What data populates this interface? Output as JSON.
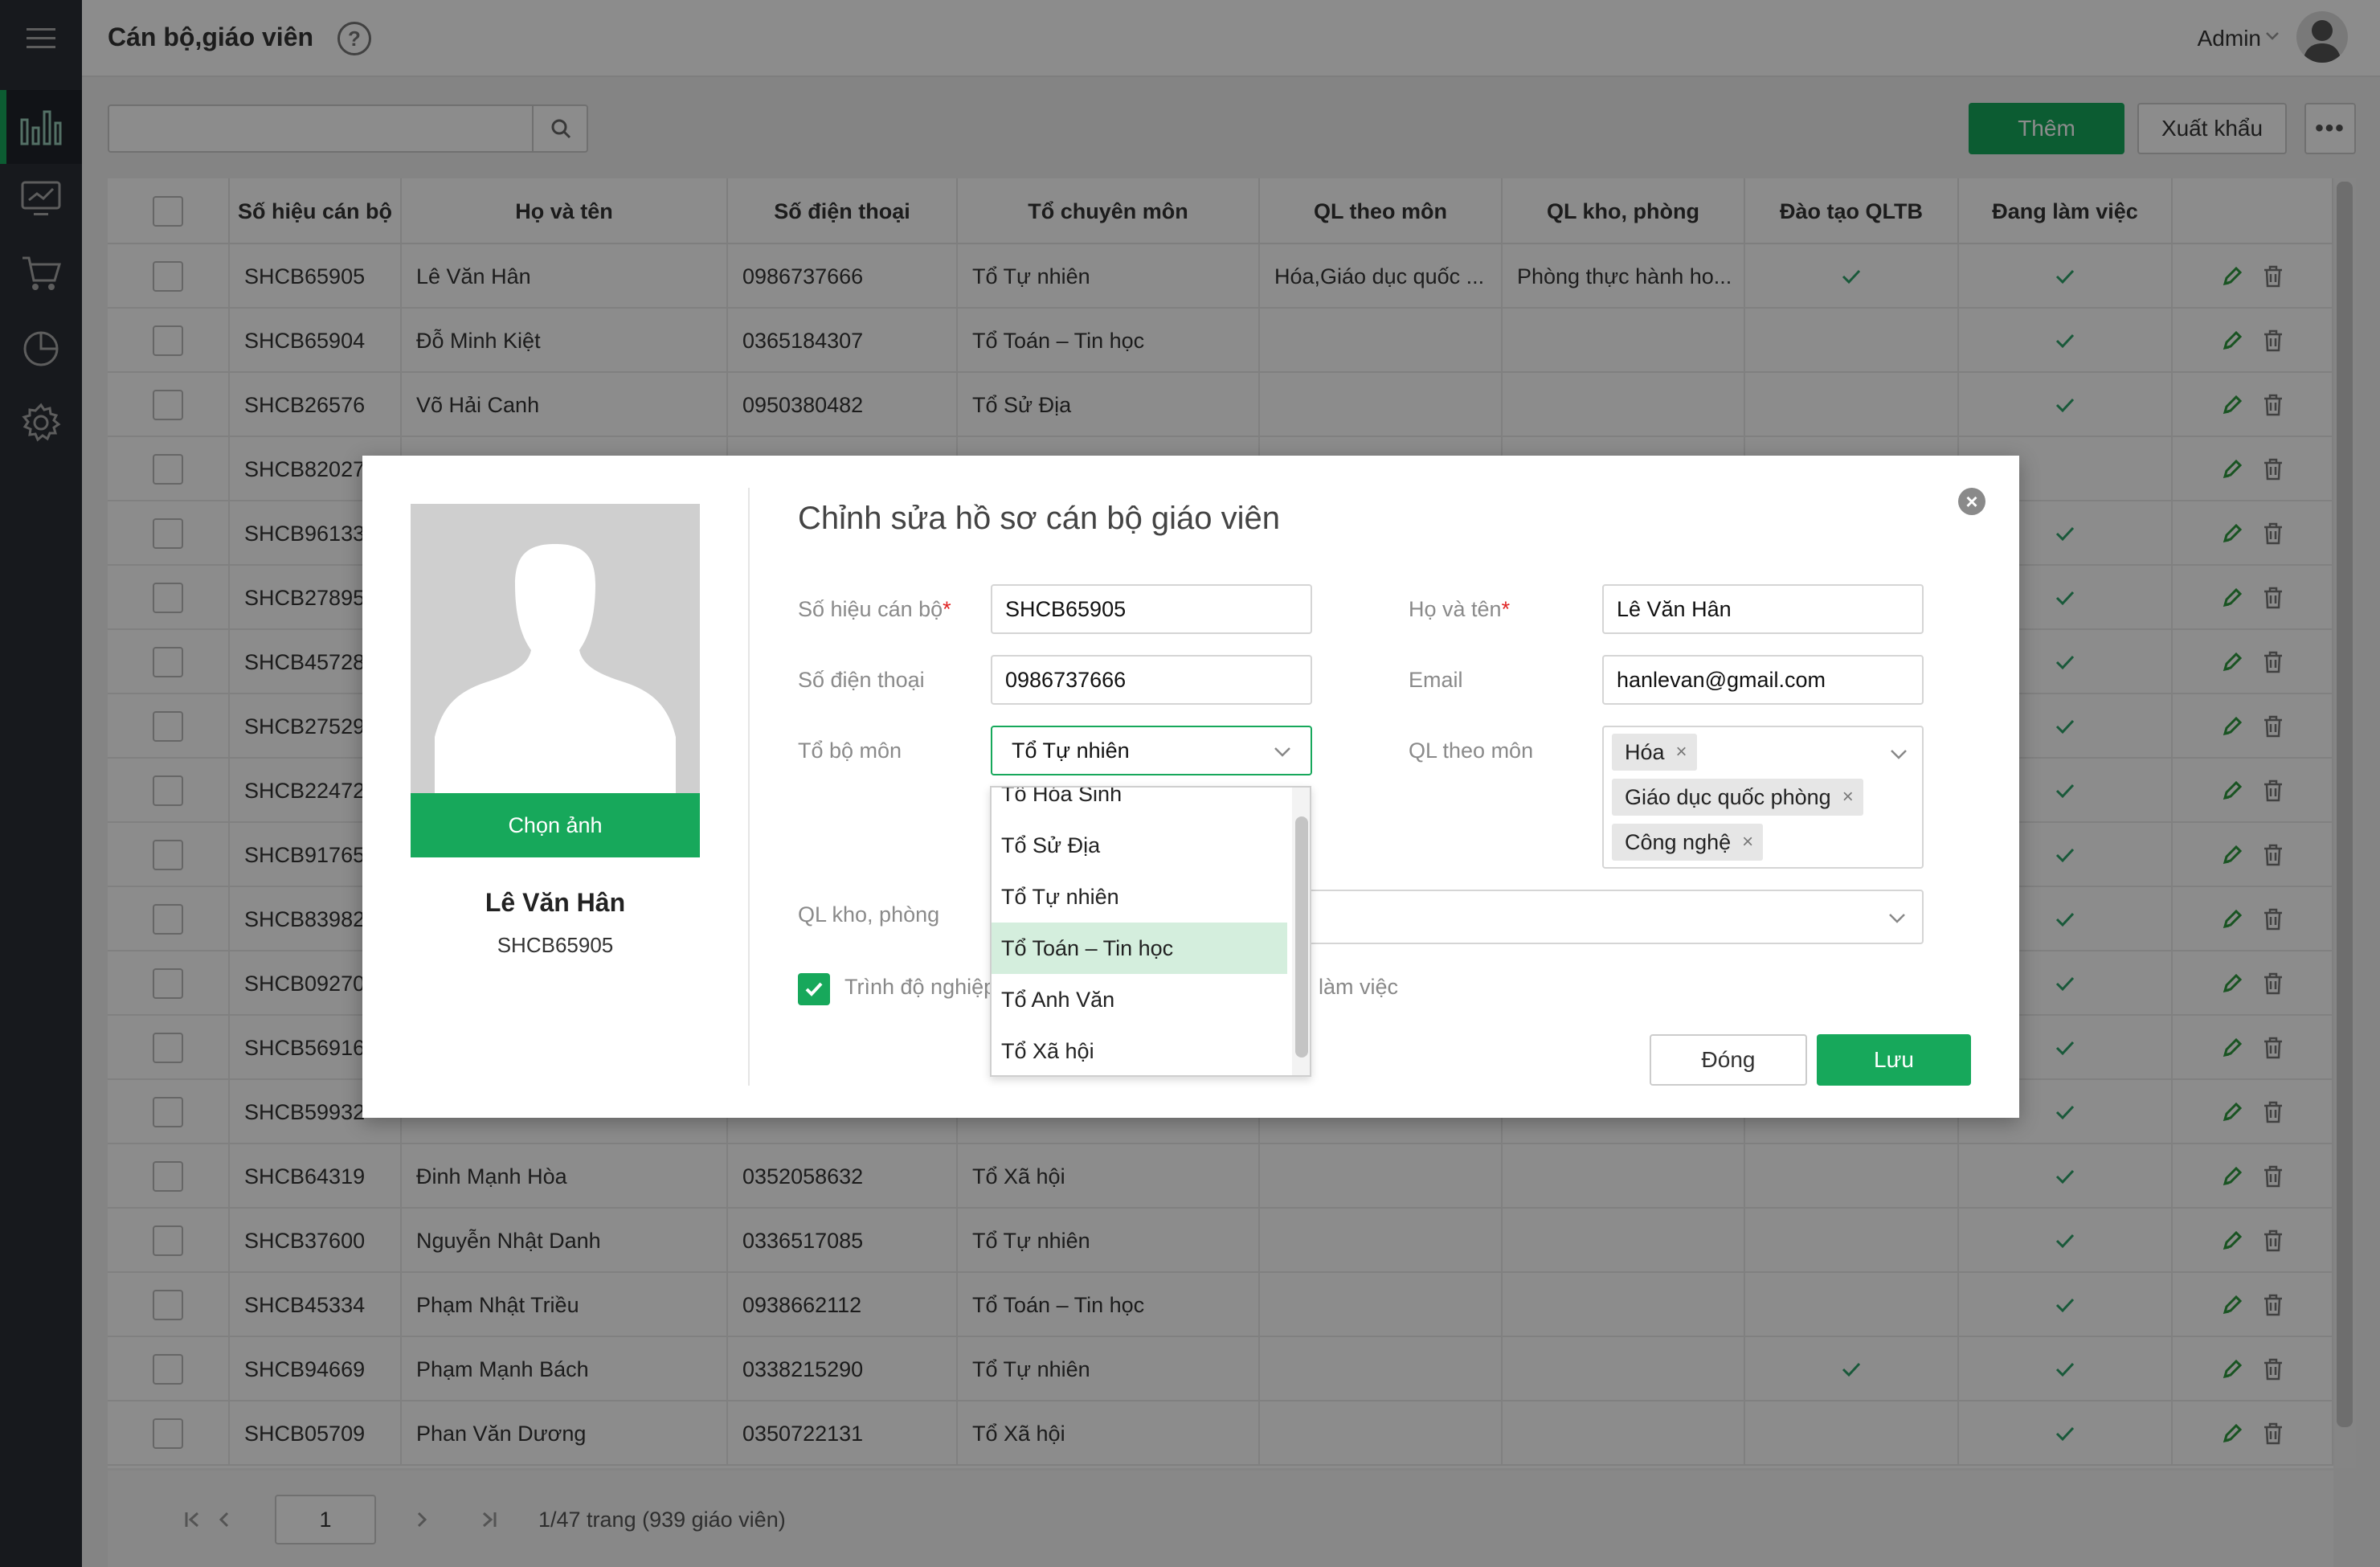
{
  "header": {
    "title": "Cán bộ,giáo viên",
    "help": "?",
    "user_name": "Admin"
  },
  "toolbar": {
    "search_placeholder": "",
    "add_label": "Thêm",
    "export_label": "Xuất khẩu",
    "more_label": "•••"
  },
  "table": {
    "headers": [
      "Số hiệu cán bộ",
      "Họ và tên",
      "Số điện thoại",
      "Tổ chuyên môn",
      "QL theo môn",
      "QL kho, phòng",
      "Đào tạo QLTB",
      "Đang làm việc"
    ],
    "rows": [
      {
        "code": "SHCB65905",
        "name": "Lê Văn Hân",
        "phone": "0986737666",
        "dept": "Tổ Tự nhiên",
        "subject": "Hóa,Giáo dục quốc ...",
        "room": "Phòng thực hành ho...",
        "trained": true,
        "active": true
      },
      {
        "code": "SHCB65904",
        "name": "Đỗ Minh Kiệt",
        "phone": "0365184307",
        "dept": "Tổ Toán – Tin học",
        "subject": "",
        "room": "",
        "trained": false,
        "active": true
      },
      {
        "code": "SHCB26576",
        "name": "Võ Hải Canh",
        "phone": "0950380482",
        "dept": "Tổ Sử Địa",
        "subject": "",
        "room": "",
        "trained": false,
        "active": true
      },
      {
        "code": "SHCB82027",
        "name": "",
        "phone": "",
        "dept": "",
        "subject": "",
        "room": "",
        "trained": false,
        "active": false
      },
      {
        "code": "SHCB96133",
        "name": "",
        "phone": "",
        "dept": "",
        "subject": "",
        "room": "",
        "trained": false,
        "active": true
      },
      {
        "code": "SHCB27895",
        "name": "",
        "phone": "",
        "dept": "",
        "subject": "",
        "room": "",
        "trained": false,
        "active": true
      },
      {
        "code": "SHCB45728",
        "name": "",
        "phone": "",
        "dept": "",
        "subject": "",
        "room": "",
        "trained": false,
        "active": true
      },
      {
        "code": "SHCB27529",
        "name": "",
        "phone": "",
        "dept": "",
        "subject": "",
        "room": "",
        "trained": false,
        "active": true
      },
      {
        "code": "SHCB22472",
        "name": "",
        "phone": "",
        "dept": "",
        "subject": "",
        "room": "",
        "trained": false,
        "active": true
      },
      {
        "code": "SHCB91765",
        "name": "",
        "phone": "",
        "dept": "",
        "subject": "",
        "room": "",
        "trained": false,
        "active": true
      },
      {
        "code": "SHCB83982",
        "name": "",
        "phone": "",
        "dept": "",
        "subject": "",
        "room": "",
        "trained": false,
        "active": true
      },
      {
        "code": "SHCB09270",
        "name": "",
        "phone": "",
        "dept": "",
        "subject": "",
        "room": "",
        "trained": false,
        "active": true
      },
      {
        "code": "SHCB56916",
        "name": "",
        "phone": "",
        "dept": "",
        "subject": "",
        "room": "",
        "trained": false,
        "active": true
      },
      {
        "code": "SHCB59932",
        "name": "",
        "phone": "",
        "dept": "",
        "subject": "",
        "room": "",
        "trained": false,
        "active": true
      },
      {
        "code": "SHCB64319",
        "name": "Đinh Mạnh Hòa",
        "phone": "0352058632",
        "dept": "Tổ Xã hội",
        "subject": "",
        "room": "",
        "trained": false,
        "active": true
      },
      {
        "code": "SHCB37600",
        "name": "Nguyễn Nhật Danh",
        "phone": "0336517085",
        "dept": "Tổ Tự nhiên",
        "subject": "",
        "room": "",
        "trained": false,
        "active": true
      },
      {
        "code": "SHCB45334",
        "name": "Phạm Nhật Triều",
        "phone": "0938662112",
        "dept": "Tổ Toán – Tin học",
        "subject": "",
        "room": "",
        "trained": false,
        "active": true
      },
      {
        "code": "SHCB94669",
        "name": "Phạm Mạnh Bách",
        "phone": "0338215290",
        "dept": "Tổ Tự nhiên",
        "subject": "",
        "room": "",
        "trained": true,
        "active": true
      },
      {
        "code": "SHCB05709",
        "name": "Phan Văn Dương",
        "phone": "0350722131",
        "dept": "Tổ Xã hội",
        "subject": "",
        "room": "",
        "trained": false,
        "active": true
      }
    ]
  },
  "pagination": {
    "current_page": "1",
    "summary": "1/47 trang   (939 giáo viên)"
  },
  "modal": {
    "title": "Chỉnh sửa hồ sơ cán bộ giáo viên",
    "photo_button": "Chọn ảnh",
    "profile_name": "Lê Văn Hân",
    "profile_code": "SHCB65905",
    "labels": {
      "code": "Số hiệu cán bộ",
      "name": "Họ và tên",
      "phone": "Số điện thoại",
      "email": "Email",
      "dept": "Tổ bộ môn",
      "subject": "QL theo môn",
      "room": "QL kho, phòng",
      "qualification": "Trình độ nghiệp",
      "status": "làm việc"
    },
    "required_mark": "*",
    "values": {
      "code": "SHCB65905",
      "name": "Lê Văn Hân",
      "phone": "0986737666",
      "email": "hanlevan@gmail.com",
      "dept": "Tổ Tự nhiên"
    },
    "subject_tags": [
      "Hóa",
      "Giáo dục quốc phòng",
      "Công nghệ"
    ],
    "tag_remove": "×",
    "close_label": "Đóng",
    "save_label": "Lưu"
  },
  "dropdown": {
    "options": [
      "Tổ Hóa Sinh",
      "Tổ Sử Địa",
      "Tổ Tự nhiên",
      "Tổ Toán – Tin học",
      "Tổ Anh Văn",
      "Tổ Xã hội"
    ],
    "highlighted": "Tổ Toán – Tin học"
  },
  "colors": {
    "accent": "#17a85b",
    "sidebar": "#2b2f36",
    "required": "#e02424"
  },
  "icons": [
    "menu-icon",
    "chart-icon",
    "monitor-icon",
    "cart-icon",
    "pie-icon",
    "gear-icon",
    "help-icon",
    "search-icon",
    "check-icon",
    "edit-icon",
    "trash-icon",
    "close-icon",
    "chevron-down-icon"
  ]
}
